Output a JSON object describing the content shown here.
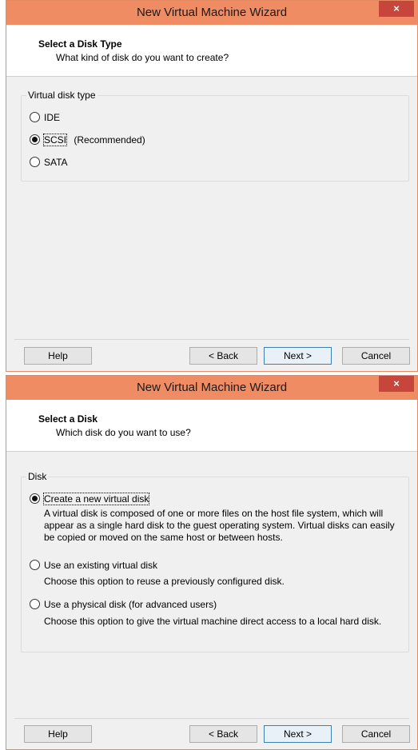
{
  "window1": {
    "title": "New Virtual Machine Wizard",
    "close_label": "×",
    "header_title": "Select a Disk Type",
    "header_subtitle": "What kind of disk do you want to create?",
    "group_label": "Virtual disk type",
    "options": [
      {
        "label": "IDE",
        "checked": false
      },
      {
        "label": "SCSI",
        "note": "(Recommended)",
        "checked": true
      },
      {
        "label": "SATA",
        "checked": false
      }
    ],
    "buttons": {
      "help": "Help",
      "back": "< Back",
      "next": "Next >",
      "cancel": "Cancel"
    }
  },
  "window2": {
    "title": "New Virtual Machine Wizard",
    "close_label": "×",
    "header_title": "Select a Disk",
    "header_subtitle": "Which disk do you want to use?",
    "group_label": "Disk",
    "options": [
      {
        "label": "Create a new virtual disk",
        "checked": true,
        "description": "A virtual disk is composed of one or more files on the host file system, which will appear as a single hard disk to the guest operating system. Virtual disks can easily be copied or moved on the same host or between hosts."
      },
      {
        "label": "Use an existing virtual disk",
        "checked": false,
        "description": "Choose this option to reuse a previously configured disk."
      },
      {
        "label": "Use a physical disk (for advanced users)",
        "checked": false,
        "description": "Choose this option to give the virtual machine direct access to a local hard disk."
      }
    ],
    "buttons": {
      "help": "Help",
      "back": "< Back",
      "next": "Next >",
      "cancel": "Cancel"
    }
  },
  "colors": {
    "titlebar": "#f08c63",
    "close": "#c7463c",
    "dialog_bg": "#f0f0f0"
  }
}
